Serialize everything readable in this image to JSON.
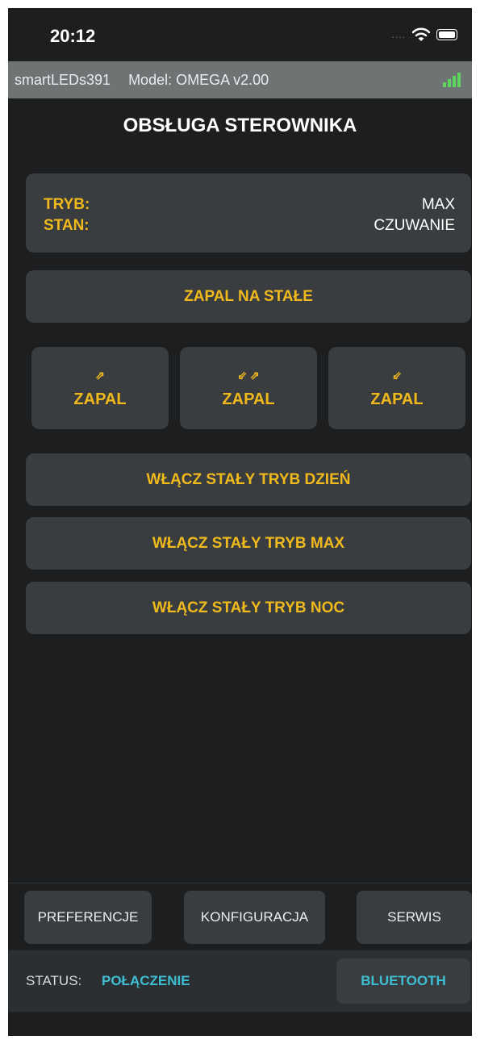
{
  "statusbar": {
    "time": "20:12",
    "dots": "....",
    "wifi_icon": "wifi-icon",
    "battery_icon": "battery-icon"
  },
  "device": {
    "name": "smartLEDs391",
    "model": "Model: OMEGA v2.00",
    "signal_icon": "signal-bars-icon"
  },
  "page_title": "OBSŁUGA STEROWNIKA",
  "info": {
    "tryb_label": "TRYB:",
    "tryb_value": "MAX",
    "stan_label": "STAN:",
    "stan_value": "CZUWANIE"
  },
  "buttons": {
    "zapal_na_stale": "ZAPAL NA STAŁE",
    "zapal_up": {
      "arrows": "⇗",
      "label": "ZAPAL"
    },
    "zapal_both": {
      "arrows": "⇙ ⇗",
      "label": "ZAPAL"
    },
    "zapal_down": {
      "arrows": "⇙",
      "label": "ZAPAL"
    },
    "tryb_dzien": "WŁĄCZ STAŁY TRYB DZIEŃ",
    "tryb_max": "WŁĄCZ STAŁY TRYB MAX",
    "tryb_noc": "WŁĄCZ STAŁY TRYB NOC"
  },
  "tabs": {
    "preferencje": "PREFERENCJE",
    "konfiguracja": "KONFIGURACJA",
    "serwis": "SERWIS"
  },
  "footer": {
    "status_label": "STATUS:",
    "status_value": "POŁĄCZENIE",
    "bluetooth_button": "BLUETOOTH"
  },
  "colors": {
    "accent": "#f0b91c",
    "status": "#3fbed3",
    "background": "#1c1e20",
    "card": "#3a3d40"
  }
}
